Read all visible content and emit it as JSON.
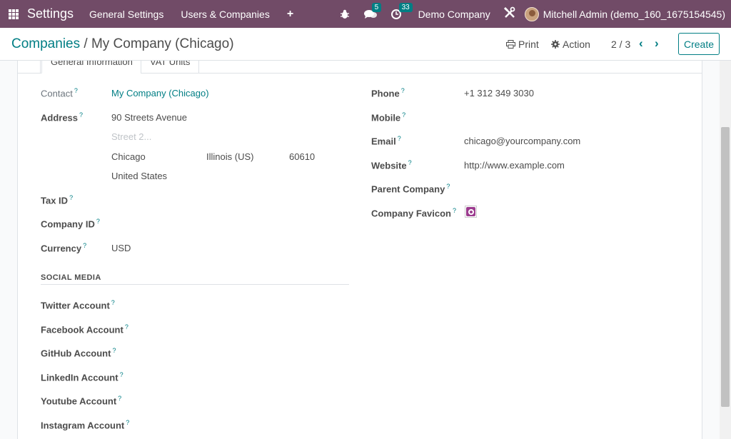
{
  "navbar": {
    "app_title": "Settings",
    "menu": [
      "General Settings",
      "Users & Companies"
    ],
    "plus": "+",
    "messages_count": "5",
    "activities_count": "33",
    "company": "Demo Company",
    "user": "Mitchell Admin (demo_160_1675154545)",
    "color": "#714b67"
  },
  "control_panel": {
    "breadcrumb_parent": "Companies",
    "breadcrumb_sep": " / ",
    "breadcrumb_current": "My Company (Chicago)",
    "print_label": "Print",
    "action_label": "Action",
    "pager": "2 / 3",
    "create_label": "Create",
    "accent": "#017e84"
  },
  "tabs": [
    "General Information",
    "VAT Units"
  ],
  "left_fields": {
    "contact_label": "Contact",
    "contact_value": "My Company (Chicago)",
    "address_label": "Address",
    "street": "90 Streets Avenue",
    "street2_placeholder": "Street 2...",
    "city": "Chicago",
    "state": "Illinois (US)",
    "zip": "60610",
    "country": "United States",
    "tax_id_label": "Tax ID",
    "company_id_label": "Company ID",
    "currency_label": "Currency",
    "currency_value": "USD"
  },
  "social": {
    "title": "SOCIAL MEDIA",
    "twitter": "Twitter Account",
    "facebook": "Facebook Account",
    "github": "GitHub Account",
    "linkedin": "LinkedIn Account",
    "youtube": "Youtube Account",
    "instagram": "Instagram Account"
  },
  "right_fields": {
    "phone_label": "Phone",
    "phone_value": "+1 312 349 3030",
    "mobile_label": "Mobile",
    "email_label": "Email",
    "email_value": "chicago@yourcompany.com",
    "website_label": "Website",
    "website_value": "http://www.example.com",
    "parent_label": "Parent Company",
    "favicon_label": "Company Favicon"
  },
  "help_mark": "?"
}
